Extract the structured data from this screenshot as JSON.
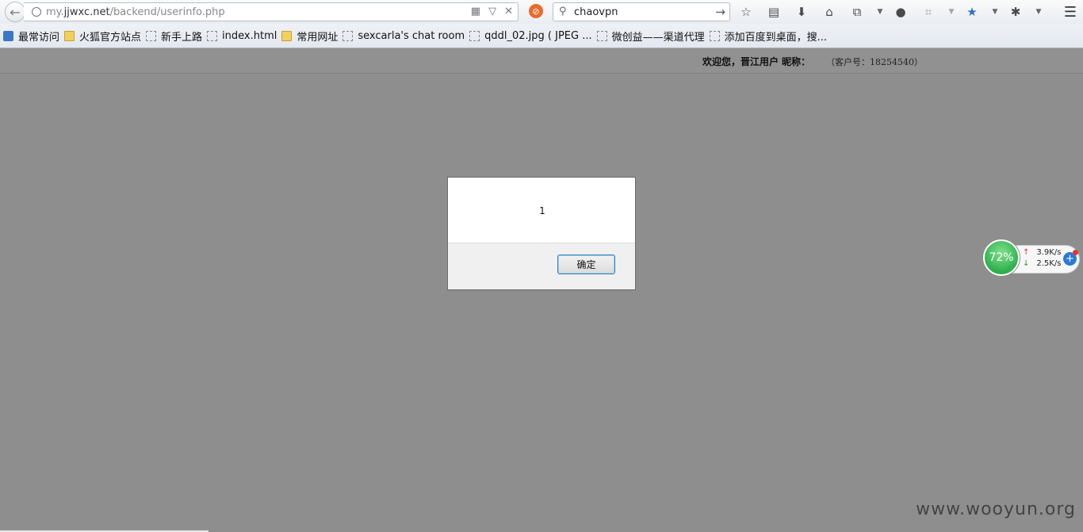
{
  "browser": {
    "url_prefix": "my.",
    "url_domain": "jjwxc.net",
    "url_path": "/backend/userinfo.php",
    "search_text": "chaovpn"
  },
  "bookmarks": [
    {
      "label": "最常访问",
      "kind": "app"
    },
    {
      "label": "火狐官方站点",
      "kind": "folder"
    },
    {
      "label": "新手上路",
      "kind": "page"
    },
    {
      "label": "index.html",
      "kind": "page"
    },
    {
      "label": "常用网址",
      "kind": "folder"
    },
    {
      "label": "sexcarla's chat room",
      "kind": "page"
    },
    {
      "label": "qddl_02.jpg ( JPEG ...",
      "kind": "page"
    },
    {
      "label": "微创益——渠道代理",
      "kind": "page"
    },
    {
      "label": "添加百度到桌面，搜...",
      "kind": "page"
    }
  ],
  "page": {
    "welcome_text": "欢迎您，晋江用户  昵称：",
    "customer_no": "（客户号：18254540）"
  },
  "dialog": {
    "message": "1",
    "ok_label": "确定"
  },
  "net_widget": {
    "percent": "72%",
    "upload": "3.9K/s",
    "download": "2.5K/s"
  },
  "watermark": "www.wooyun.org"
}
